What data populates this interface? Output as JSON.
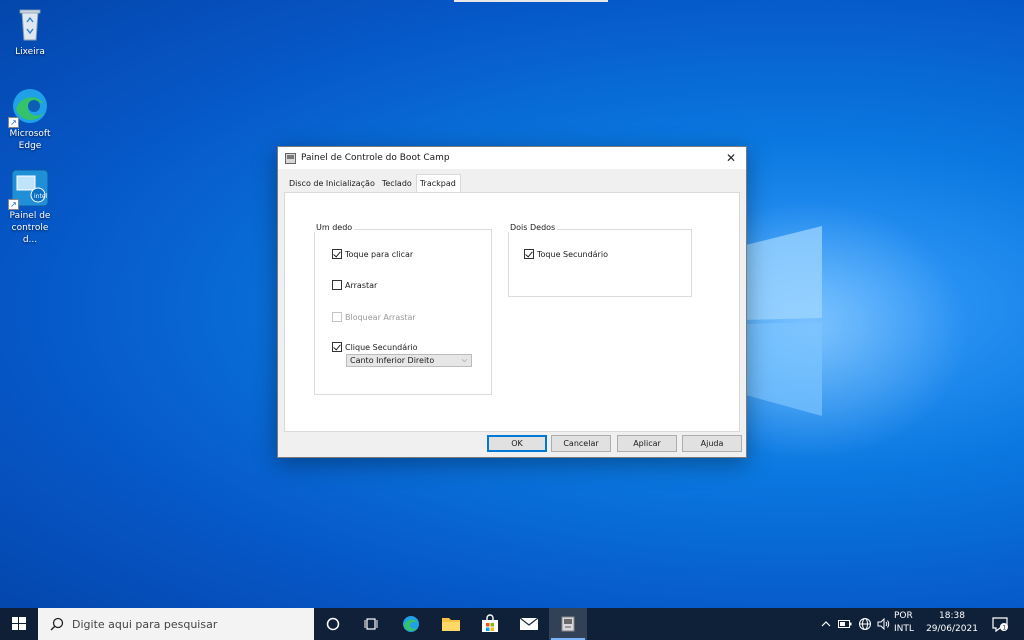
{
  "desktop": {
    "icons": [
      {
        "label": "Lixeira"
      },
      {
        "label": "Microsoft Edge"
      },
      {
        "label": "Painel de controle d..."
      }
    ]
  },
  "dialog": {
    "title": "Painel de Controle do Boot Camp",
    "close_glyph": "✕",
    "tabs": [
      {
        "label": "Disco de Inicialização"
      },
      {
        "label": "Teclado"
      },
      {
        "label": "Trackpad",
        "active": true
      }
    ],
    "group_one": {
      "label": "Um dedo",
      "options": [
        {
          "label": "Toque para clicar",
          "checked": true,
          "enabled": true
        },
        {
          "label": "Arrastar",
          "checked": false,
          "enabled": true
        },
        {
          "label": "Bloquear Arrastar",
          "checked": false,
          "enabled": false
        },
        {
          "label": "Clique Secundário",
          "checked": true,
          "enabled": true
        }
      ],
      "select_value": "Canto Inferior Direito"
    },
    "group_two": {
      "label": "Dois Dedos",
      "options": [
        {
          "label": "Toque Secundário",
          "checked": true,
          "enabled": true
        }
      ]
    },
    "buttons": {
      "ok": "OK",
      "cancel": "Cancelar",
      "apply": "Aplicar",
      "help": "Ajuda"
    }
  },
  "taskbar": {
    "search_placeholder": "Digite aqui para pesquisar",
    "lang_line1": "POR",
    "lang_line2": "INTL",
    "time": "18:38",
    "date": "29/06/2021",
    "notification_count": "1"
  },
  "colors": {
    "accent": "#0078d7",
    "desktop": "#0a78e0",
    "taskbar": "#101c2c"
  }
}
